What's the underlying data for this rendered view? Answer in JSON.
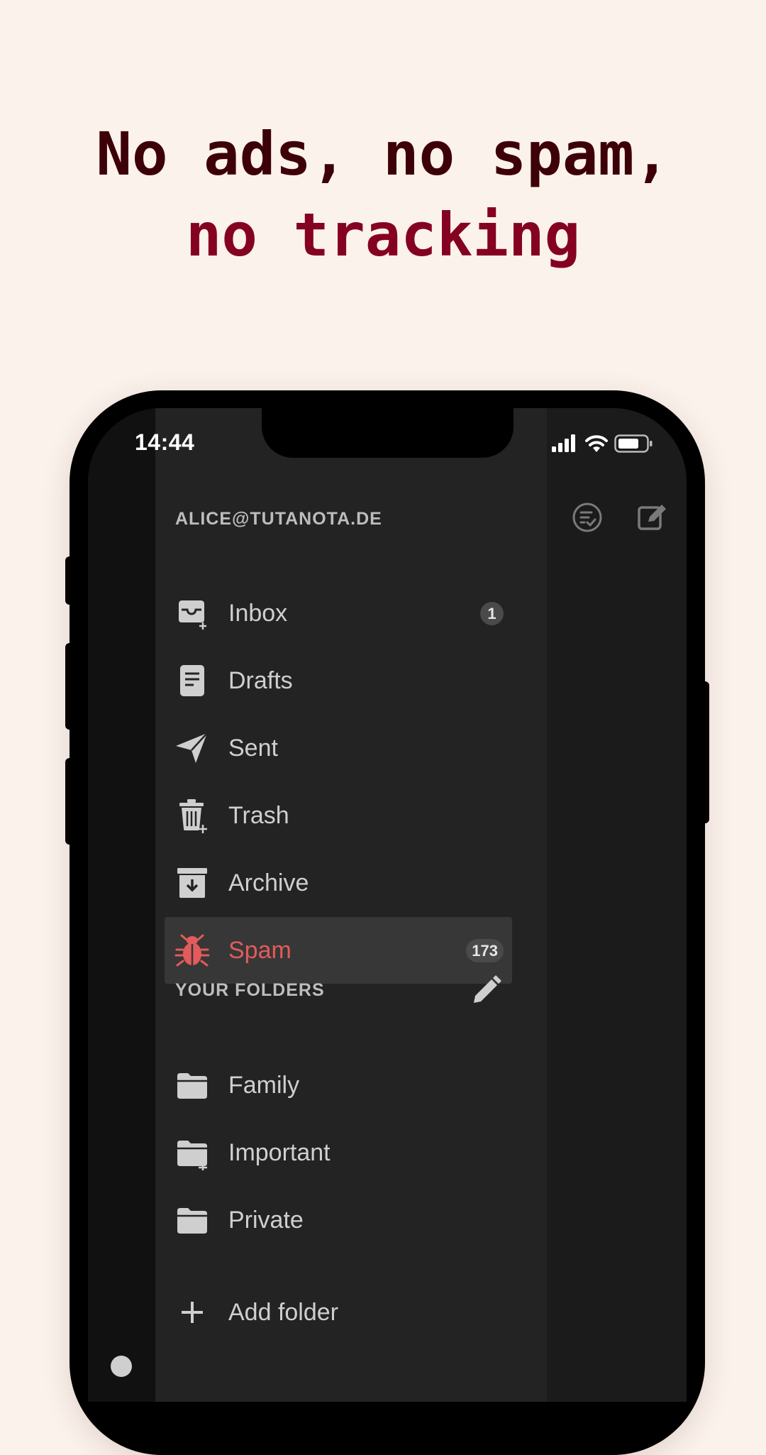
{
  "headline": {
    "line1": "No ads, no spam,",
    "line2": "no tracking"
  },
  "colors": {
    "background": "#fbf2ec",
    "headline_dark": "#3d0008",
    "headline_accent": "#850122",
    "spam_red": "#e35b5b"
  },
  "status_bar": {
    "time": "14:44",
    "icons": [
      "signal-icon",
      "wifi-icon",
      "battery-icon"
    ]
  },
  "drawer": {
    "account": "ALICE@TUTANOTA.DE",
    "header_actions": [
      "select-all-icon",
      "compose-icon"
    ],
    "system_folders": [
      {
        "label": "Inbox",
        "icon": "inbox-icon",
        "badge": "1",
        "selected": false
      },
      {
        "label": "Drafts",
        "icon": "document-icon",
        "badge": "",
        "selected": false
      },
      {
        "label": "Sent",
        "icon": "send-icon",
        "badge": "",
        "selected": false
      },
      {
        "label": "Trash",
        "icon": "trash-icon",
        "badge": "",
        "selected": false
      },
      {
        "label": "Archive",
        "icon": "archive-icon",
        "badge": "",
        "selected": false
      },
      {
        "label": "Spam",
        "icon": "bug-icon",
        "badge": "173",
        "selected": true
      }
    ],
    "your_folders_title": "YOUR FOLDERS",
    "custom_folders": [
      {
        "label": "Family",
        "icon": "folder-icon"
      },
      {
        "label": "Important",
        "icon": "folder-icon"
      },
      {
        "label": "Private",
        "icon": "folder-icon"
      }
    ],
    "add_folder_label": "Add folder"
  }
}
